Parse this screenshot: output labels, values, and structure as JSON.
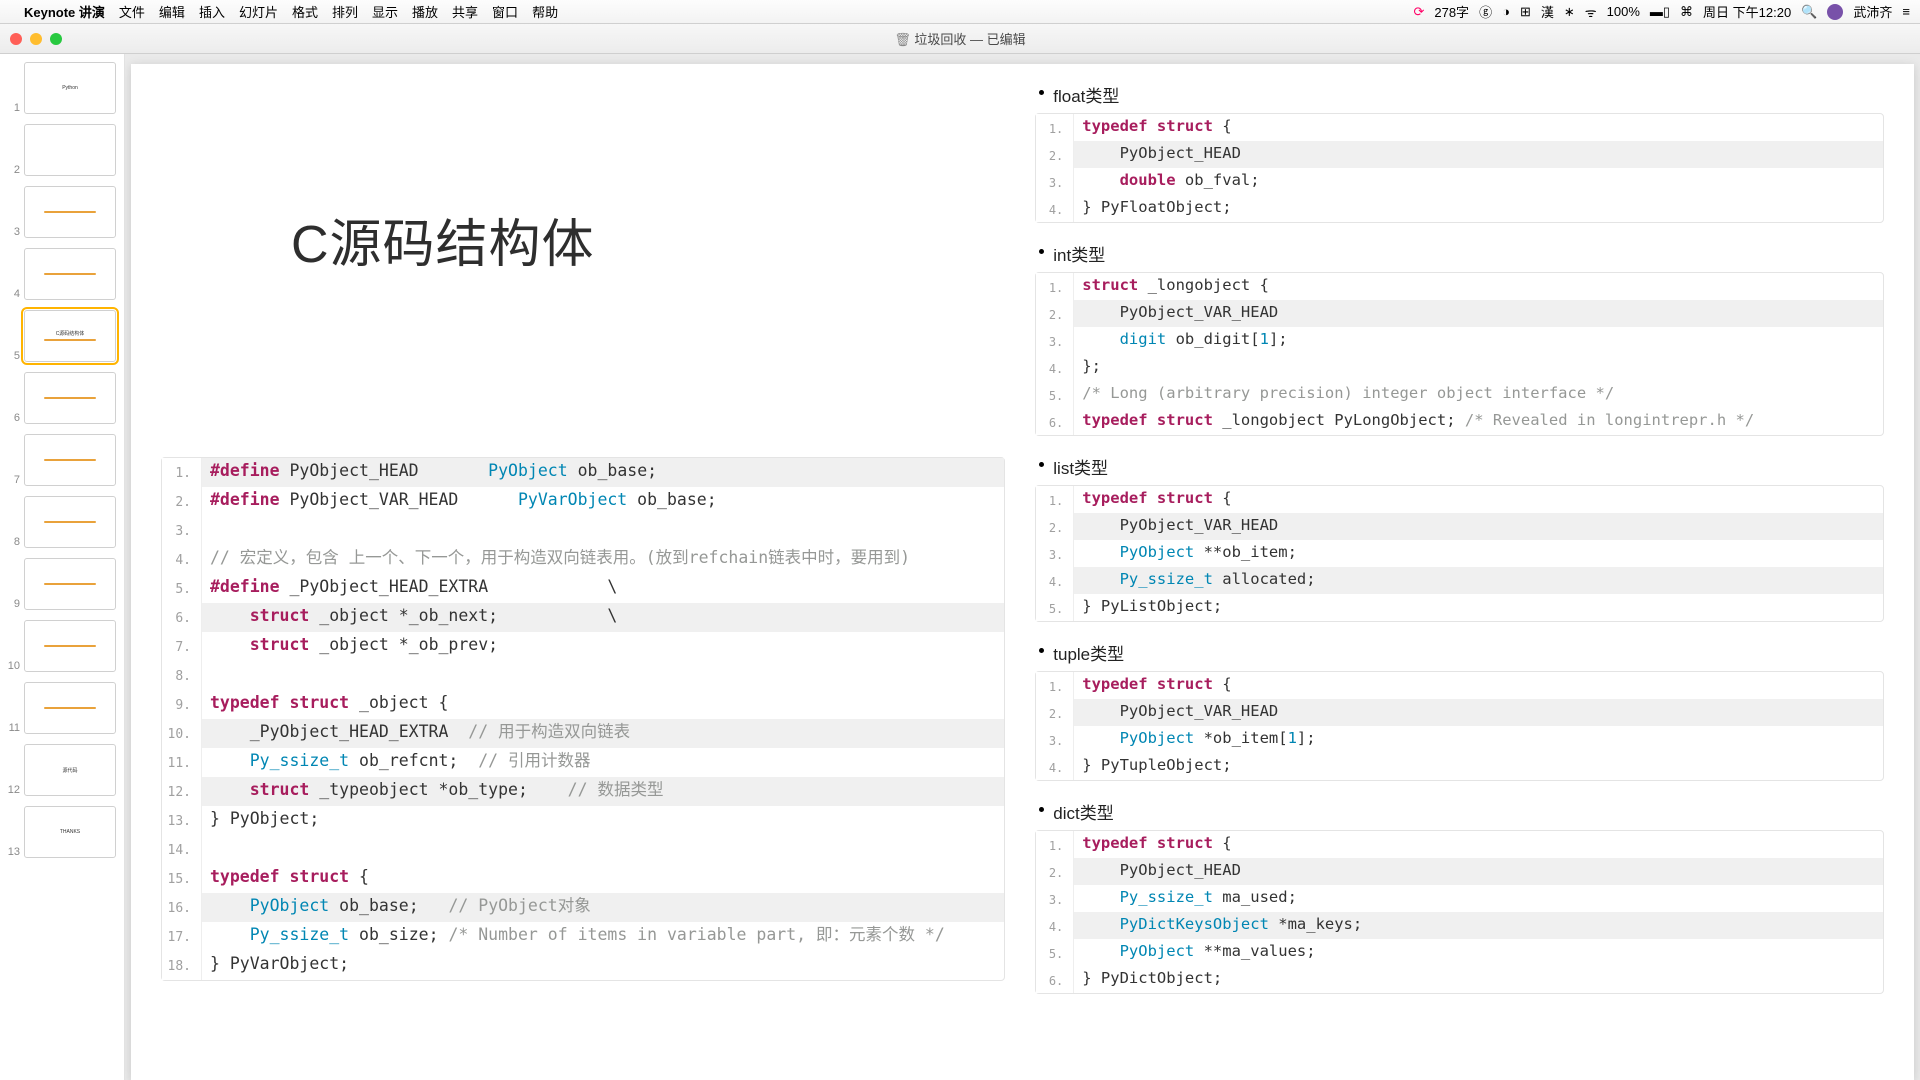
{
  "menubar": {
    "app": "Keynote 讲演",
    "items": [
      "文件",
      "编辑",
      "插入",
      "幻灯片",
      "格式",
      "排列",
      "显示",
      "播放",
      "共享",
      "窗口",
      "帮助"
    ],
    "right": {
      "word_count": "278字",
      "wifi": "100%",
      "battery_icon": true,
      "clock": "周日 下午12:20",
      "username": "武沛齐"
    }
  },
  "titlebar": {
    "title": "垃圾回收 — 已编辑"
  },
  "thumbnails": {
    "count": 13,
    "selected": 5,
    "labels": [
      "Python",
      "",
      "",
      "",
      "C源码结构体",
      "",
      "",
      "",
      "",
      "",
      "",
      "源代码",
      "THANKS"
    ]
  },
  "slide": {
    "title": "C源码结构体"
  },
  "code_left": [
    {
      "n": 1,
      "hl": true,
      "segs": [
        [
          "kw",
          "#define"
        ],
        [
          "nm",
          " PyObject_HEAD       "
        ],
        [
          "ty",
          "PyObject"
        ],
        [
          "nm",
          " ob_base;"
        ]
      ]
    },
    {
      "n": 2,
      "segs": [
        [
          "kw",
          "#define"
        ],
        [
          "nm",
          " PyObject_VAR_HEAD      "
        ],
        [
          "ty",
          "PyVarObject"
        ],
        [
          "nm",
          " ob_base;"
        ]
      ]
    },
    {
      "n": 3,
      "segs": [
        [
          "nm",
          ""
        ]
      ]
    },
    {
      "n": 4,
      "segs": [
        [
          "cm",
          "// 宏定义，包含 上一个、下一个，用于构造双向链表用。(放到refchain链表中时，要用到)"
        ]
      ]
    },
    {
      "n": 5,
      "segs": [
        [
          "kw",
          "#define"
        ],
        [
          "nm",
          " _PyObject_HEAD_EXTRA            \\"
        ]
      ]
    },
    {
      "n": 6,
      "hl": true,
      "segs": [
        [
          "nm",
          "    "
        ],
        [
          "kw",
          "struct"
        ],
        [
          "nm",
          " _object *_ob_next;           \\"
        ]
      ]
    },
    {
      "n": 7,
      "segs": [
        [
          "nm",
          "    "
        ],
        [
          "kw",
          "struct"
        ],
        [
          "nm",
          " _object *_ob_prev;"
        ]
      ]
    },
    {
      "n": 8,
      "segs": [
        [
          "nm",
          ""
        ]
      ]
    },
    {
      "n": 9,
      "segs": [
        [
          "kw",
          "typedef struct"
        ],
        [
          "nm",
          " _object {"
        ]
      ]
    },
    {
      "n": 10,
      "hl": true,
      "segs": [
        [
          "nm",
          "    _PyObject_HEAD_EXTRA  "
        ],
        [
          "cm",
          "// 用于构造双向链表"
        ]
      ]
    },
    {
      "n": 11,
      "segs": [
        [
          "nm",
          "    "
        ],
        [
          "ty",
          "Py_ssize_t"
        ],
        [
          "nm",
          " ob_refcnt;  "
        ],
        [
          "cm",
          "// 引用计数器"
        ]
      ]
    },
    {
      "n": 12,
      "hl": true,
      "segs": [
        [
          "nm",
          "    "
        ],
        [
          "kw",
          "struct"
        ],
        [
          "nm",
          " _typeobject *ob_type;    "
        ],
        [
          "cm",
          "// 数据类型"
        ]
      ]
    },
    {
      "n": 13,
      "segs": [
        [
          "nm",
          "} PyObject;"
        ]
      ]
    },
    {
      "n": 14,
      "segs": [
        [
          "nm",
          ""
        ]
      ]
    },
    {
      "n": 15,
      "segs": [
        [
          "kw",
          "typedef struct"
        ],
        [
          "nm",
          " {"
        ]
      ]
    },
    {
      "n": 16,
      "hl": true,
      "segs": [
        [
          "nm",
          "    "
        ],
        [
          "ty",
          "PyObject"
        ],
        [
          "nm",
          " ob_base;   "
        ],
        [
          "cm",
          "// PyObject对象"
        ]
      ]
    },
    {
      "n": 17,
      "segs": [
        [
          "nm",
          "    "
        ],
        [
          "ty",
          "Py_ssize_t"
        ],
        [
          "nm",
          " ob_size; "
        ],
        [
          "cm",
          "/* Number of items in variable part, 即：元素个数 */"
        ]
      ]
    },
    {
      "n": 18,
      "segs": [
        [
          "nm",
          "} PyVarObject;"
        ]
      ]
    }
  ],
  "sections_right": [
    {
      "title": "float类型",
      "code": [
        {
          "n": 1,
          "segs": [
            [
              "kw",
              "typedef struct"
            ],
            [
              "nm",
              " {"
            ]
          ]
        },
        {
          "n": 2,
          "hl": true,
          "segs": [
            [
              "nm",
              "    PyObject_HEAD"
            ]
          ]
        },
        {
          "n": 3,
          "segs": [
            [
              "nm",
              "    "
            ],
            [
              "kw",
              "double"
            ],
            [
              "nm",
              " ob_fval;"
            ]
          ]
        },
        {
          "n": 4,
          "segs": [
            [
              "nm",
              "} PyFloatObject;"
            ]
          ]
        }
      ]
    },
    {
      "title": "int类型",
      "code": [
        {
          "n": 1,
          "segs": [
            [
              "kw",
              "struct"
            ],
            [
              "nm",
              " _longobject {"
            ]
          ]
        },
        {
          "n": 2,
          "hl": true,
          "segs": [
            [
              "nm",
              "    PyObject_VAR_HEAD"
            ]
          ]
        },
        {
          "n": 3,
          "segs": [
            [
              "nm",
              "    "
            ],
            [
              "ty",
              "digit"
            ],
            [
              "nm",
              " ob_digit["
            ],
            [
              "ty",
              "1"
            ],
            [
              "nm",
              "];"
            ]
          ]
        },
        {
          "n": 4,
          "segs": [
            [
              "nm",
              "};"
            ]
          ]
        },
        {
          "n": 5,
          "segs": [
            [
              "cm",
              "/* Long (arbitrary precision) integer object interface */"
            ]
          ]
        },
        {
          "n": 6,
          "segs": [
            [
              "kw",
              "typedef struct"
            ],
            [
              "nm",
              " _longobject PyLongObject; "
            ],
            [
              "cm",
              "/* Revealed in longintrepr.h */"
            ]
          ]
        }
      ]
    },
    {
      "title": "list类型",
      "code": [
        {
          "n": 1,
          "segs": [
            [
              "kw",
              "typedef struct"
            ],
            [
              "nm",
              " {"
            ]
          ]
        },
        {
          "n": 2,
          "hl": true,
          "segs": [
            [
              "nm",
              "    PyObject_VAR_HEAD"
            ]
          ]
        },
        {
          "n": 3,
          "segs": [
            [
              "nm",
              "    "
            ],
            [
              "ty",
              "PyObject"
            ],
            [
              "nm",
              " **ob_item;"
            ]
          ]
        },
        {
          "n": 4,
          "hl": true,
          "segs": [
            [
              "nm",
              "    "
            ],
            [
              "ty",
              "Py_ssize_t"
            ],
            [
              "nm",
              " allocated;"
            ]
          ]
        },
        {
          "n": 5,
          "segs": [
            [
              "nm",
              "} PyListObject;"
            ]
          ]
        }
      ]
    },
    {
      "title": "tuple类型",
      "code": [
        {
          "n": 1,
          "segs": [
            [
              "kw",
              "typedef struct"
            ],
            [
              "nm",
              " {"
            ]
          ]
        },
        {
          "n": 2,
          "hl": true,
          "segs": [
            [
              "nm",
              "    PyObject_VAR_HEAD"
            ]
          ]
        },
        {
          "n": 3,
          "segs": [
            [
              "nm",
              "    "
            ],
            [
              "ty",
              "PyObject"
            ],
            [
              "nm",
              " *ob_item["
            ],
            [
              "ty",
              "1"
            ],
            [
              "nm",
              "];"
            ]
          ]
        },
        {
          "n": 4,
          "segs": [
            [
              "nm",
              "} PyTupleObject;"
            ]
          ]
        }
      ]
    },
    {
      "title": "dict类型",
      "code": [
        {
          "n": 1,
          "segs": [
            [
              "kw",
              "typedef struct"
            ],
            [
              "nm",
              " {"
            ]
          ]
        },
        {
          "n": 2,
          "hl": true,
          "segs": [
            [
              "nm",
              "    PyObject_HEAD"
            ]
          ]
        },
        {
          "n": 3,
          "segs": [
            [
              "nm",
              "    "
            ],
            [
              "ty",
              "Py_ssize_t"
            ],
            [
              "nm",
              " ma_used;"
            ]
          ]
        },
        {
          "n": 4,
          "hl": true,
          "segs": [
            [
              "nm",
              "    "
            ],
            [
              "ty",
              "PyDictKeysObject"
            ],
            [
              "nm",
              " *ma_keys;"
            ]
          ]
        },
        {
          "n": 5,
          "segs": [
            [
              "nm",
              "    "
            ],
            [
              "ty",
              "PyObject"
            ],
            [
              "nm",
              " **ma_values;"
            ]
          ]
        },
        {
          "n": 6,
          "segs": [
            [
              "nm",
              "} PyDictObject;"
            ]
          ]
        }
      ]
    }
  ],
  "watermark": ""
}
